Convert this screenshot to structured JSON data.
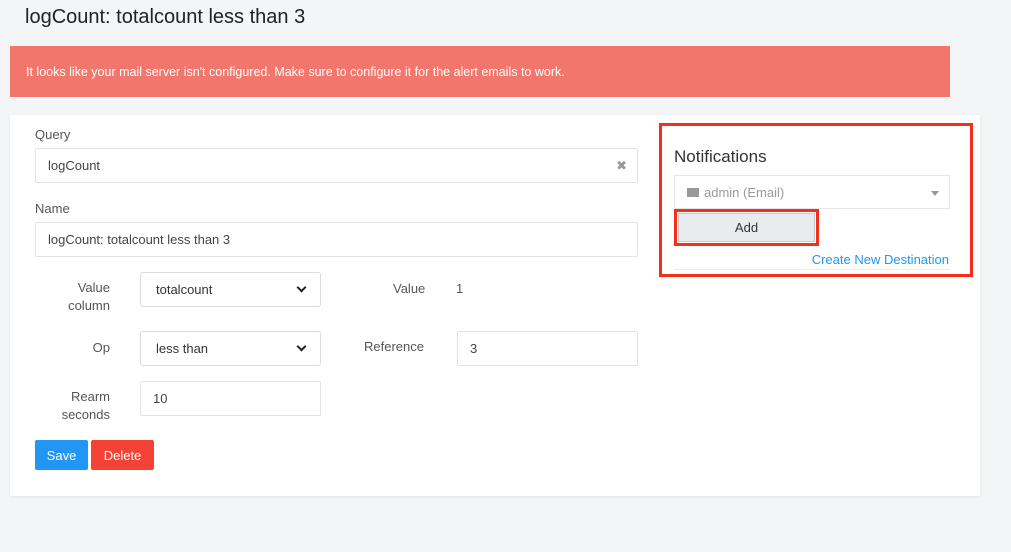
{
  "page_title": "logCount: totalcount less than 3",
  "alert_message": "It looks like your mail server isn't configured. Make sure to configure it for the alert emails to work.",
  "form": {
    "query_label": "Query",
    "query_value": "logCount",
    "query_clear": "✖",
    "name_label": "Name",
    "name_value": "logCount: totalcount less than 3",
    "value_column_label_1": "Value",
    "value_column_label_2": "column",
    "value_column_selected": "totalcount",
    "value_label": "Value",
    "value_value": "1",
    "op_label": "Op",
    "op_selected": "less than",
    "reference_label": "Reference",
    "reference_value": "3",
    "rearm_label_1": "Rearm",
    "rearm_label_2": "seconds",
    "rearm_value": "10",
    "save_label": "Save",
    "delete_label": "Delete"
  },
  "notifications": {
    "title": "Notifications",
    "destination_selected": "admin (Email)",
    "add_label": "Add",
    "create_link": "Create New Destination"
  },
  "colors": {
    "alert_bg": "#f2766c",
    "save_bg": "#2196f3",
    "delete_bg": "#f44336",
    "highlight": "#f2301b",
    "link": "#2196f3"
  },
  "icons": {
    "destination": "envelope-icon",
    "clear": "clear-icon",
    "select": "chevron-down-icon"
  }
}
